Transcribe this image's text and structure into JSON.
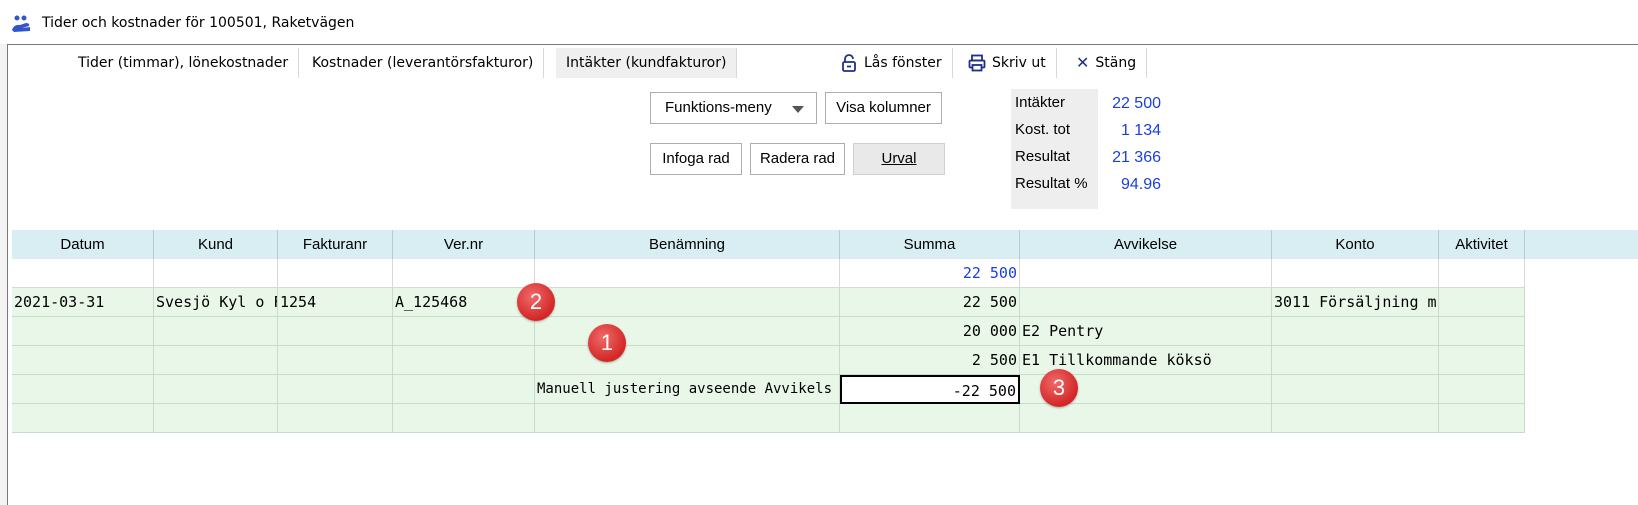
{
  "window": {
    "title": "Tider och kostnader för 100501, Raketvägen"
  },
  "tabs": [
    {
      "label": "Tider (timmar), lönekostnader"
    },
    {
      "label": "Kostnader (leverantörsfakturor)"
    },
    {
      "label": "Intäkter (kundfakturor)",
      "active": true
    }
  ],
  "toolbar": {
    "lock_label": "Lås fönster",
    "print_label": "Skriv ut",
    "close_label": "Stäng"
  },
  "buttons": {
    "function_menu": "Funktions-meny",
    "show_columns": "Visa kolumner",
    "insert_row": "Infoga rad",
    "delete_row": "Radera rad",
    "selection": "Urval"
  },
  "summary": [
    {
      "label": "Intäkter",
      "value": "22 500"
    },
    {
      "label": "Kost. tot",
      "value": "1 134"
    },
    {
      "label": "Resultat",
      "value": "21 366"
    },
    {
      "label": "Resultat %",
      "value": "94.96"
    }
  ],
  "table": {
    "columns": [
      "Datum",
      "Kund",
      "Fakturanr",
      "Ver.nr",
      "Benämning",
      "Summa",
      "Avvikelse",
      "Konto",
      "Aktivitet"
    ],
    "rows": [
      [
        "",
        "",
        "",
        "",
        "",
        "22 500",
        "",
        "",
        ""
      ],
      [
        "2021-03-31",
        "Svesjö Kyl o Fr",
        "1254",
        "A_125468",
        "",
        "22 500",
        "",
        "3011 Försäljning m",
        ""
      ],
      [
        "",
        "",
        "",
        "",
        "",
        "20 000",
        "E2 Pentry",
        "",
        ""
      ],
      [
        "",
        "",
        "",
        "",
        "",
        "2 500",
        "E1 Tillkommande köksö",
        "",
        ""
      ],
      [
        "",
        "",
        "",
        "",
        "Manuell justering avseende Avvikels",
        "-22 500",
        "",
        "",
        ""
      ],
      [
        "",
        "",
        "",
        "",
        "",
        "",
        "",
        "",
        ""
      ]
    ]
  },
  "badges": [
    "1",
    "2",
    "3"
  ],
  "colors": {
    "accent_blue": "#1a3fe0",
    "header_bg": "#d8eef2",
    "row_green": "#e9f7e9",
    "badge_red": "#d32626"
  }
}
